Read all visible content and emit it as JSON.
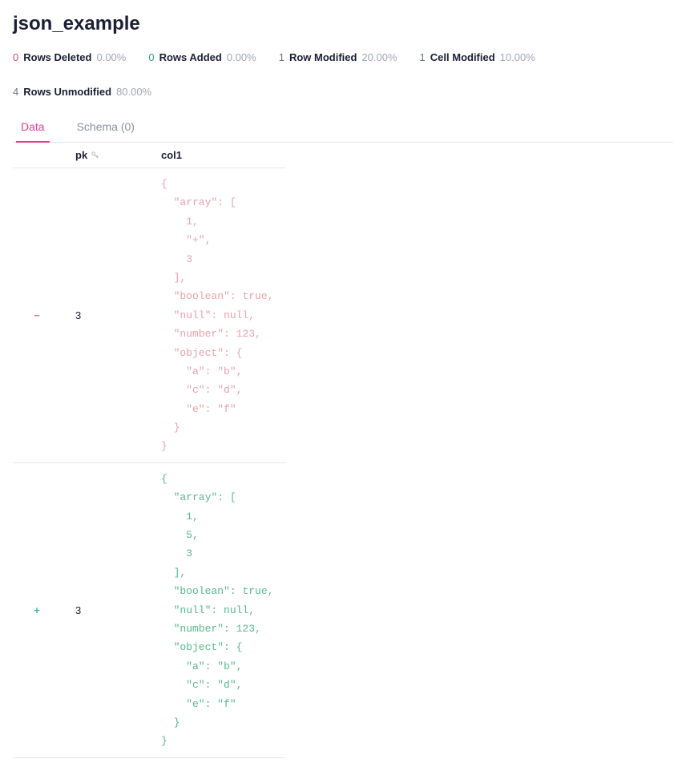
{
  "title": "json_example",
  "stats": [
    {
      "count": "0",
      "label": "Rows Deleted",
      "pct": "0.00%",
      "countClass": "count-red"
    },
    {
      "count": "0",
      "label": "Rows Added",
      "pct": "0.00%",
      "countClass": "count-green"
    },
    {
      "count": "1",
      "label": "Row Modified",
      "pct": "20.00%",
      "countClass": "count-gray"
    },
    {
      "count": "1",
      "label": "Cell Modified",
      "pct": "10.00%",
      "countClass": "count-gray"
    },
    {
      "count": "4",
      "label": "Rows Unmodified",
      "pct": "80.00%",
      "countClass": "count-gray"
    }
  ],
  "tabs": [
    {
      "label": "Data",
      "active": true
    },
    {
      "label": "Schema (0)",
      "active": false
    }
  ],
  "columns": {
    "pk": "pk",
    "col1": "col1"
  },
  "rows": [
    {
      "diff": "−",
      "diffClass": "diff-minus",
      "pk": "3",
      "jsonClass": "json-red",
      "json": "{\n  \"array\": [\n    1,\n    \"+\",\n    3\n  ],\n  \"boolean\": true,\n  \"null\": null,\n  \"number\": 123,\n  \"object\": {\n    \"a\": \"b\",\n    \"c\": \"d\",\n    \"e\": \"f\"\n  }\n}"
    },
    {
      "diff": "+",
      "diffClass": "diff-plus",
      "pk": "3",
      "jsonClass": "json-green",
      "json": "{\n  \"array\": [\n    1,\n    5,\n    3\n  ],\n  \"boolean\": true,\n  \"null\": null,\n  \"number\": 123,\n  \"object\": {\n    \"a\": \"b\",\n    \"c\": \"d\",\n    \"e\": \"f\"\n  }\n}"
    }
  ]
}
